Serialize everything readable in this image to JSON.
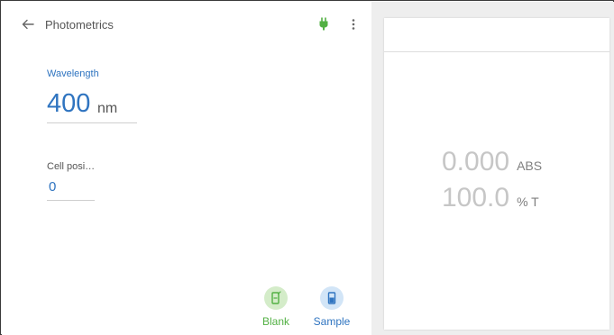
{
  "app": {
    "title": "Photometrics"
  },
  "icons": {
    "back": "arrow-back-icon",
    "plug": "plug-icon",
    "more": "more-vert-icon",
    "blank": "blank-cuvette-icon",
    "sample": "sample-cuvette-icon"
  },
  "wavelength": {
    "label": "Wavelength",
    "value": "400",
    "unit": "nm"
  },
  "cell_position": {
    "label": "Cell posi…",
    "value": "0"
  },
  "actions": {
    "blank_label": "Blank",
    "sample_label": "Sample"
  },
  "readings": {
    "abs_value": "0.000",
    "abs_unit": "ABS",
    "t_value": "100.0",
    "t_unit": "% T"
  },
  "colors": {
    "accent_blue": "#2f74c0",
    "accent_green": "#52b043",
    "reading_gray": "#c6c6c6"
  }
}
